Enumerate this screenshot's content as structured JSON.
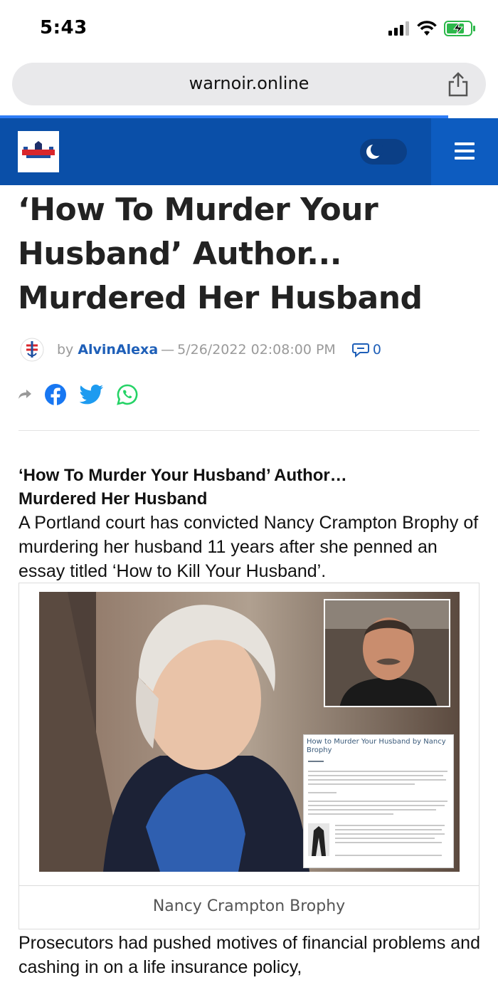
{
  "status": {
    "time": "5:43"
  },
  "browser": {
    "url": "warnoir.online"
  },
  "site": {
    "brand_color": "#0a4fa8",
    "menu_icon": "hamburger-icon",
    "theme_toggle_icon": "moon-icon"
  },
  "article": {
    "title": "‘How To Murder Your Husband’ Author... Murdered Her Husband",
    "by_label": "by",
    "author": "AlvinAlexa",
    "separator": "—",
    "date": "5/26/2022 02:08:00 PM",
    "comment_count": "0",
    "share_icons": [
      "share-arrow-icon",
      "facebook-icon",
      "twitter-icon",
      "whatsapp-icon"
    ],
    "sub_heading": "‘How To Murder Your Husband’ Author… Murdered Her Husband",
    "intro": "A Portland court has convicted Nancy Crampton Brophy of murdering her husband 11 years after she penned an essay titled ‘How to Kill Your Husband’.",
    "figure": {
      "inset_title": "How to Murder Your Husband by Nancy Brophy",
      "caption": "Nancy Crampton Brophy"
    },
    "paragraph2": "Prosecutors had pushed motives of financial problems and cashing in on a life insurance policy,"
  }
}
